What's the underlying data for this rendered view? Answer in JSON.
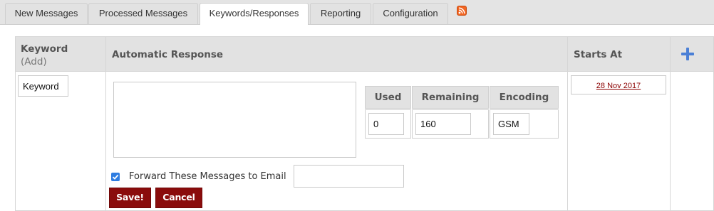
{
  "tabs": [
    {
      "label": "New Messages"
    },
    {
      "label": "Processed Messages"
    },
    {
      "label": "Keywords/Responses"
    },
    {
      "label": "Reporting"
    },
    {
      "label": "Configuration"
    }
  ],
  "active_tab": "Keywords/Responses",
  "rss_icon": "rss-icon",
  "table": {
    "headers": {
      "keyword": "Keyword",
      "keyword_add": "(Add)",
      "automatic_response": "Automatic Response",
      "starts_at": "Starts At",
      "add_symbol": "+"
    },
    "row": {
      "keyword_value": "Keyword",
      "response_text": "",
      "counters": {
        "headers": [
          "Used",
          "Remaining",
          "Encoding"
        ],
        "values": [
          "0",
          "160",
          "GSM"
        ]
      },
      "forward_label": "Forward These Messages to Email",
      "forward_checked": true,
      "forward_email": "",
      "starts_at_value": "28 Nov 2017"
    }
  },
  "buttons": {
    "save": "Save!",
    "cancel": "Cancel"
  },
  "colors": {
    "accent_button": "#8a0c0c",
    "date_link": "#8b0000",
    "plus_icon": "#4a7fd6",
    "checkbox": "#2f7de1"
  }
}
